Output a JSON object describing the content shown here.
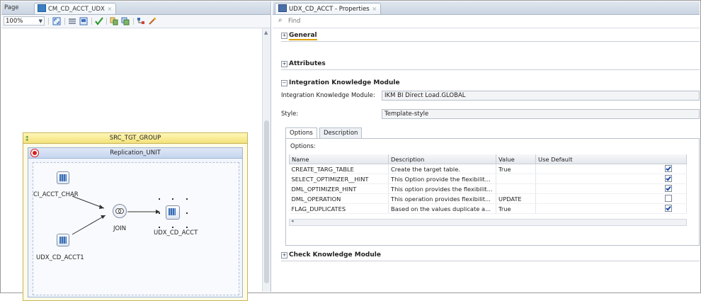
{
  "left_editor": {
    "tabs": [
      {
        "label": "Page"
      },
      {
        "label": "CM_CD_ACCT_UDX",
        "close": "×"
      }
    ],
    "zoom": {
      "value": "100%"
    },
    "group": {
      "title": "SRC_TGT_GROUP"
    },
    "unit": {
      "title": "Replication_UNIT"
    },
    "nodes": {
      "source1": "CI_ACCT_CHAR",
      "source2": "UDX_CD_ACCT1",
      "join": "JOIN",
      "target": "UDX_CD_ACCT"
    }
  },
  "properties": {
    "tab": {
      "label": "UDX_CD_ACCT - Properties",
      "close": "×"
    },
    "find": {
      "placeholder": "Find",
      "icon": "search-icon"
    },
    "sections": {
      "general": "General",
      "attributes": "Attributes",
      "ikm": "Integration Knowledge Module",
      "ckm": "Check Knowledge Module"
    },
    "ikm_fields": {
      "ikm_label": "Integration Knowledge Module:",
      "ikm_value": "IKM BI Direct Load.GLOBAL",
      "style_label": "Style:",
      "style_value": "Template-style"
    },
    "subtabs": [
      "Options",
      "Description"
    ],
    "options_label": "Options:",
    "columns": [
      "Name",
      "Description",
      "Value",
      "Use Default"
    ],
    "rows": [
      {
        "name": "CREATE_TARG_TABLE",
        "description": "Create the target table.",
        "value": "True",
        "use_default": true
      },
      {
        "name": "SELECT_OPTIMIZER__HINT",
        "description": "This Option provide the flexibilit...",
        "value": "",
        "use_default": true
      },
      {
        "name": "DML_OPTIMIZER_HINT",
        "description": "This option provides the flexibilit...",
        "value": "",
        "use_default": true
      },
      {
        "name": "DML_OPERATION",
        "description": "This operation provides flexibilit...",
        "value": "UPDATE",
        "use_default": false
      },
      {
        "name": "FLAG_DUPLICATES",
        "description": "Based on the values duplicate a...",
        "value": "True",
        "use_default": true
      }
    ]
  }
}
